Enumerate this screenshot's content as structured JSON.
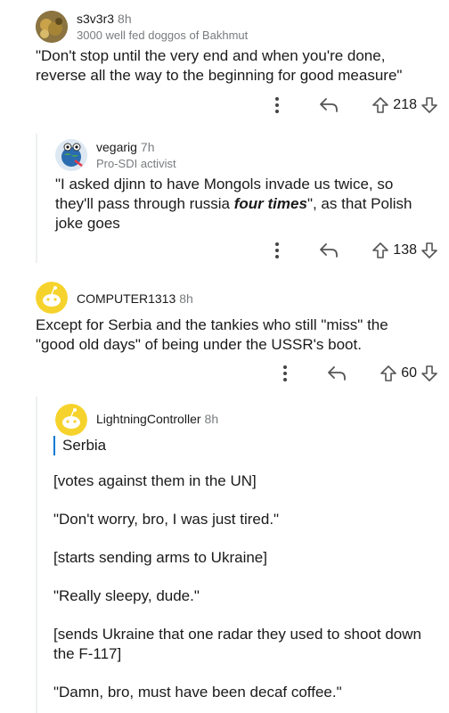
{
  "comments": [
    {
      "username": "s3v3r3",
      "age": "8h",
      "flair": "3000 well fed doggos of Bakhmut",
      "body": "\"Don't stop until the very end and when you're done, reverse all the way to the beginning for good measure\"",
      "score": "218"
    },
    {
      "username": "vegarig",
      "age": "7h",
      "flair": "Pro-SDI activist",
      "body_pre": "\"I asked djinn to have Mongols invade us twice, so they'll pass through russia ",
      "body_em": "four times",
      "body_post": "\", as that Polish joke goes",
      "score": "138"
    },
    {
      "username": "COMPUTER1313",
      "age": "8h",
      "body": "Except for Serbia and the tankies who still \"miss\" the \"good old days\" of being under the USSR's boot.",
      "score": "60"
    },
    {
      "username": "LightningController",
      "age": "8h",
      "quote": "Serbia",
      "paragraphs": [
        "[votes against them in the UN]",
        "\"Don't worry, bro, I was just tired.\"",
        "[starts sending arms to Ukraine]",
        "\"Really sleepy, dude.\"",
        "[sends Ukraine that one radar they used to shoot down the F-117]",
        "\"Damn, bro, must have been decaf coffee.\""
      ]
    }
  ],
  "icons": {
    "more": "more-options-icon",
    "reply": "reply-icon",
    "upvote": "upvote-icon",
    "downvote": "downvote-icon"
  },
  "colors": {
    "quote_bar": "#0079d3",
    "snoo_yellow": "#f6d32c"
  }
}
